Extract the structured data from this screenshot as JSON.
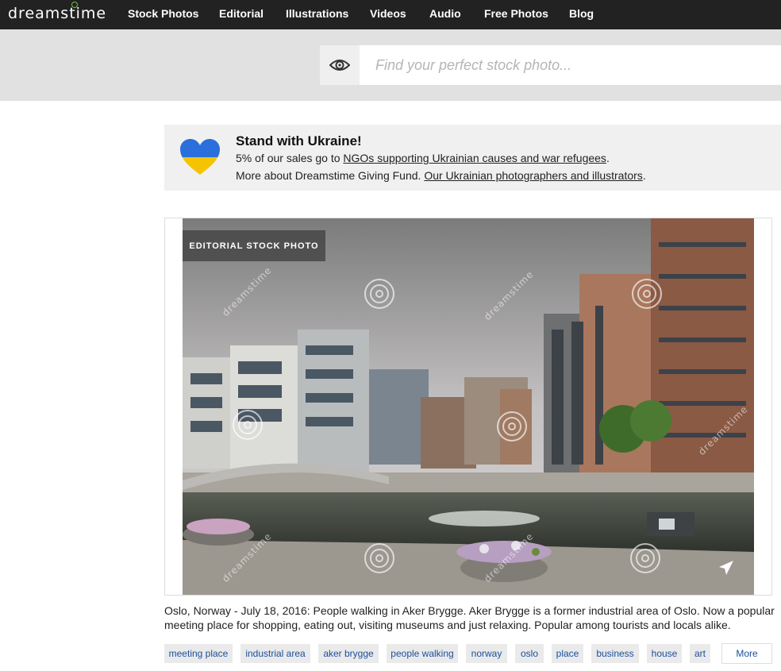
{
  "header": {
    "logo_text": "dreamstime",
    "nav": [
      "Stock Photos",
      "Editorial",
      "Illustrations",
      "Videos",
      "Audio",
      "Free Photos",
      "Blog"
    ]
  },
  "search": {
    "placeholder": "Find your perfect stock photo..."
  },
  "ukraine_banner": {
    "title": "Stand with Ukraine!",
    "line1_prefix": "5% of our sales go to ",
    "line1_link": "NGOs supporting Ukrainian causes and war refugees",
    "line1_suffix": ".",
    "line2_prefix": "More about Dreamstime Giving Fund. ",
    "line2_link": "Our Ukrainian photographers and illustrators",
    "line2_suffix": ".",
    "heart_colors": [
      "#2a6fdb",
      "#f5c400"
    ]
  },
  "photo": {
    "badge": "EDITORIAL STOCK PHOTO",
    "watermark": "dreamstime",
    "share_icon": "send-arrow-icon"
  },
  "caption": "Oslo, Norway - July 18, 2016: People walking in Aker Brygge. Aker Brygge is a former industrial area of Oslo. Now a popular meeting place for shopping, eating out, visiting museums and just relaxing. Popular among tourists and locals alike.",
  "tags": [
    "meeting place",
    "industrial area",
    "aker brygge",
    "people walking",
    "norway",
    "oslo",
    "place",
    "business",
    "house",
    "art"
  ],
  "more_label": "More",
  "colors": {
    "nav_bg": "#222222",
    "tag_text": "#1b4f9c",
    "search_band": "#e1e1e1"
  }
}
